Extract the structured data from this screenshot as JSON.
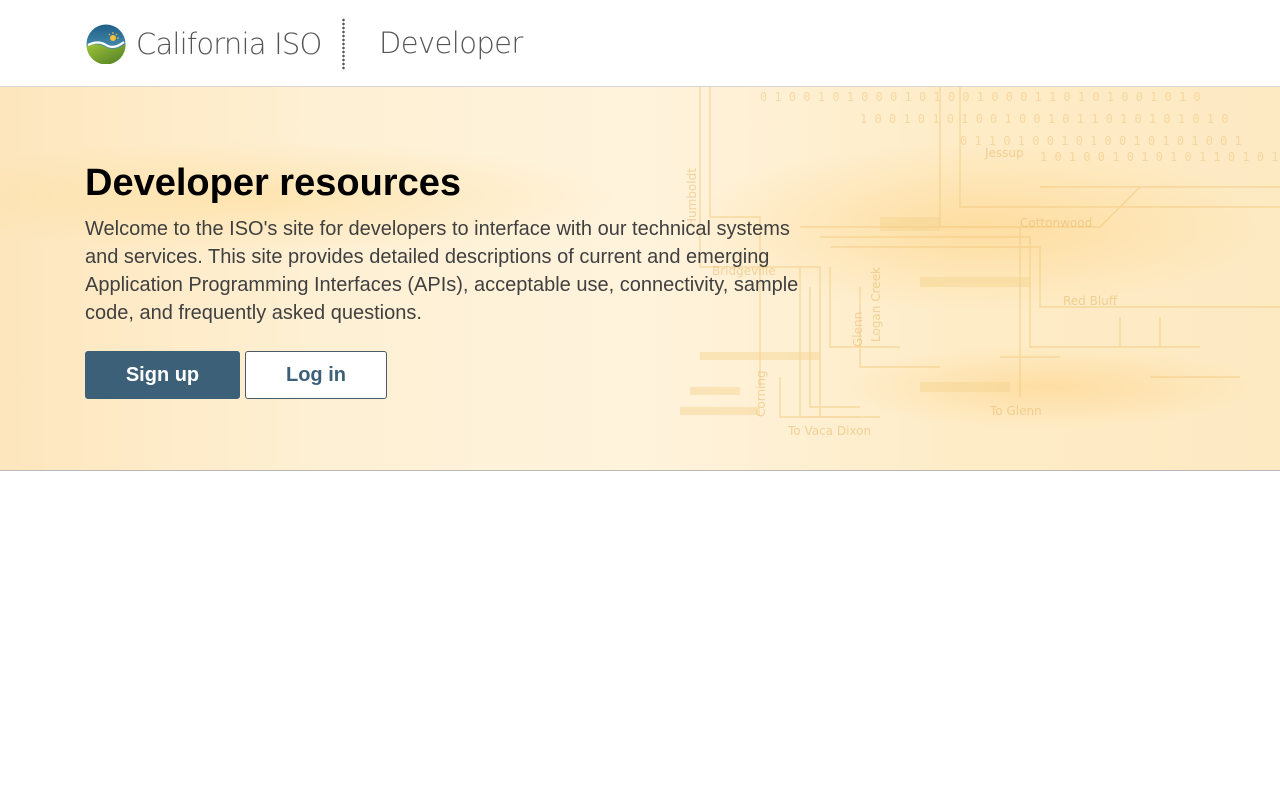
{
  "header": {
    "org_name": "California ISO",
    "product_name": "Developer",
    "logo_icon": "california-iso-logo"
  },
  "hero": {
    "title": "Developer resources",
    "description": "Welcome to the ISO's site for developers to interface with our technical systems and services. This site provides detailed descriptions of current and emerging Application Programming Interfaces (APIs), acceptable use, connectivity, sample code, and frequently asked questions.",
    "buttons": {
      "signup_label": "Sign up",
      "login_label": "Log in"
    },
    "background_labels": [
      "Humboldt",
      "Bridgeville",
      "Logan Creek",
      "Glenn",
      "Cottonwood",
      "Red Bluff",
      "Corning",
      "To Vaca Dixon",
      "To Glenn",
      "Jessup"
    ]
  },
  "colors": {
    "primary_button": "#3d6079",
    "primary_button_text": "#ffffff",
    "secondary_button_text": "#3d6079",
    "hero_background": "#fef0d4",
    "title_text": "#000000",
    "body_text": "#404040"
  }
}
